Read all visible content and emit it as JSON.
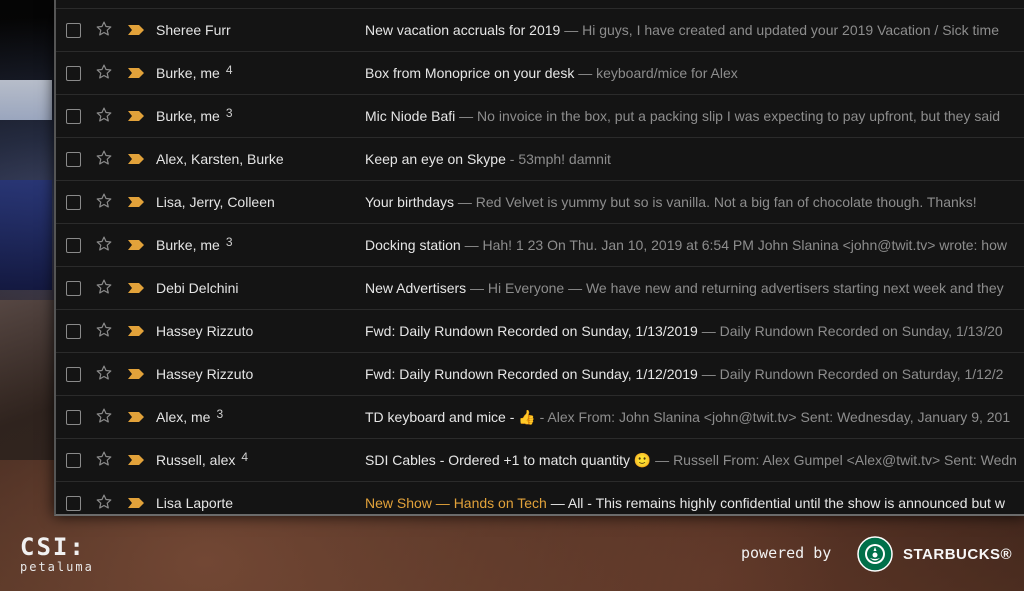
{
  "inbox": {
    "rows": [
      {
        "sender": "Sheree Furr",
        "count": "",
        "subject": "New vacation accruals for 2019",
        "snippet": " — Hi guys, I have created and updated your 2019 Vacation / Sick time"
      },
      {
        "sender": "Burke, me",
        "count": "4",
        "subject": "Box from Monoprice on your desk",
        "snippet": " — keyboard/mice for Alex"
      },
      {
        "sender": "Burke, me",
        "count": "3",
        "subject": "Mic Niode Bafi",
        "snippet": " — No invoice in the box, put a packing slip I was expecting to pay upfront, but they said"
      },
      {
        "sender": "Alex, Karsten, Burke",
        "count": "",
        "subject": "Keep an eye on Skype",
        "snippet": " - 53mph! damnit"
      },
      {
        "sender": "Lisa, Jerry, Colleen",
        "count": "",
        "subject": "Your birthdays",
        "snippet": " — Red Velvet is yummy but so is vanilla. Not a big fan of chocolate though. Thanks!"
      },
      {
        "sender": "Burke, me",
        "count": "3",
        "subject": "Docking station",
        "snippet": " — Hah! 1 23 On Thu. Jan 10, 2019 at 6:54 PM John Slanina <john@twit.tv> wrote: how"
      },
      {
        "sender": "Debi Delchini",
        "count": "",
        "subject": "New Advertisers",
        "snippet": " — Hi Everyone — We have new and returning advertisers starting next week and they"
      },
      {
        "sender": "Hassey Rizzuto",
        "count": "",
        "subject": "Fwd: Daily Rundown Recorded on Sunday, 1/13/2019",
        "snippet": " — Daily Rundown Recorded on Sunday, 1/13/20"
      },
      {
        "sender": "Hassey Rizzuto",
        "count": "",
        "subject": "Fwd: Daily Rundown Recorded on Sunday, 1/12/2019",
        "snippet": " — Daily Rundown Recorded on Saturday, 1/12/2"
      },
      {
        "sender": "Alex, me",
        "count": "3",
        "subject": "TD keyboard and mice - 👍",
        "snippet": " - Alex From: John Slanina <john@twit.tv> Sent: Wednesday, January 9, 201"
      },
      {
        "sender": "Russell, alex",
        "count": "4",
        "subject": "SDI Cables - Ordered +1 to match quantity 🙂",
        "snippet": " — Russell From: Alex Gumpel <Alex@twit.tv> Sent: Wedn"
      },
      {
        "sender": "Lisa Laporte",
        "count": "",
        "subject": "New Show — Hands on Tech",
        "snippet": " — All - This remains highly confidential until the show is announced but w"
      }
    ]
  },
  "footer": {
    "csi_title": "CSI:",
    "csi_sub": "petaluma",
    "powered_by": "powered by",
    "sponsor": "STARBUCKS®"
  },
  "colors": {
    "important_marker": "#e2a23a",
    "panel_bg": "#141414",
    "highlight_text": "#e2a23a"
  },
  "icons": [
    "checkbox-icon",
    "star-icon",
    "important-marker-icon",
    "starbucks-logo-icon"
  ]
}
